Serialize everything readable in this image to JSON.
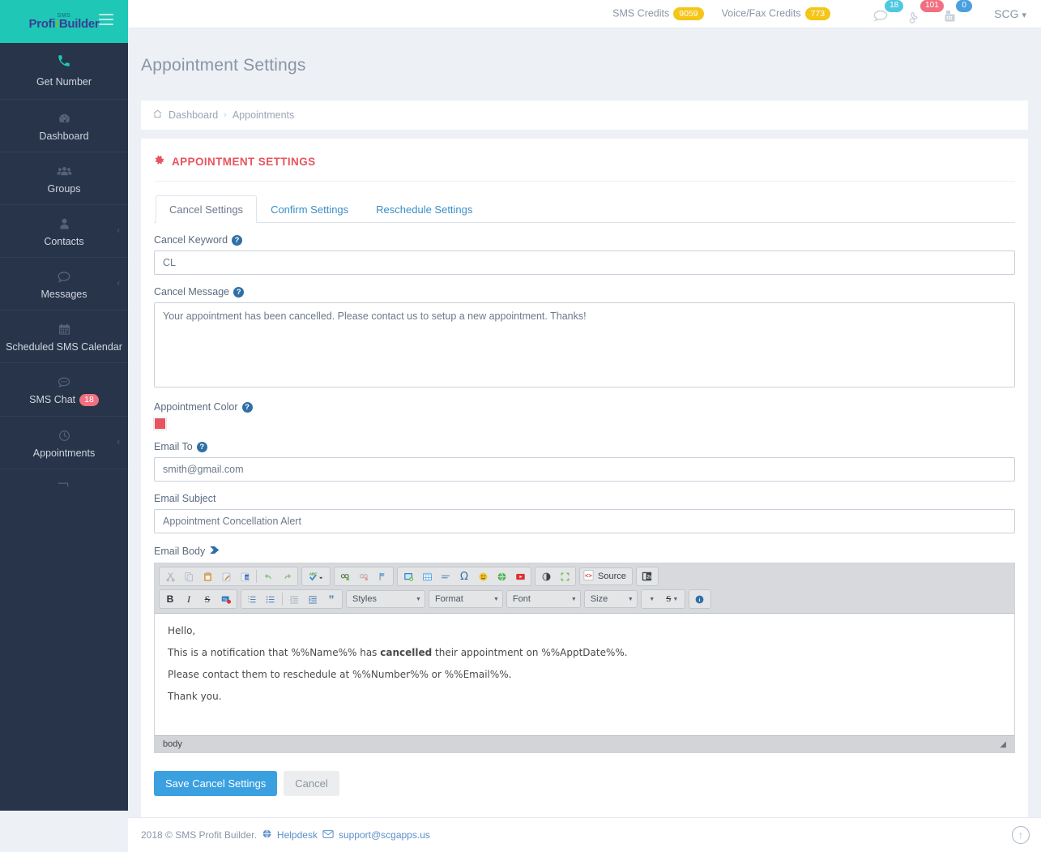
{
  "brand": {
    "top": "SMS",
    "name_part1": "Profi",
    "name_part2": "t",
    "name_part3": "Builder"
  },
  "sidebar": {
    "get_number": {
      "label": "Get Number",
      "icon": "phone-icon"
    },
    "items": [
      {
        "label": "Dashboard",
        "icon": "dashboard-icon",
        "caret": false,
        "badge": null
      },
      {
        "label": "Groups",
        "icon": "groups-icon",
        "caret": false,
        "badge": null
      },
      {
        "label": "Contacts",
        "icon": "contact-icon",
        "caret": true,
        "badge": null
      },
      {
        "label": "Messages",
        "icon": "message-icon",
        "caret": true,
        "badge": null
      },
      {
        "label": "Scheduled SMS Calendar",
        "icon": "calendar-icon",
        "caret": false,
        "badge": null
      },
      {
        "label": "SMS Chat",
        "icon": "chat-icon",
        "caret": false,
        "badge": "18"
      },
      {
        "label": "Appointments",
        "icon": "clock-icon",
        "caret": true,
        "badge": null
      }
    ]
  },
  "topbar": {
    "sms_credits_label": "SMS Credits",
    "sms_credits_value": "9059",
    "voice_fax_label": "Voice/Fax Credits",
    "voice_fax_value": "773",
    "icons": [
      {
        "name": "chat-bubble-icon",
        "badge": "18",
        "badge_color": "#4ec8e0"
      },
      {
        "name": "phone-icon",
        "badge": "101",
        "badge_color": "#f1707f"
      },
      {
        "name": "fax-icon",
        "badge": "0",
        "badge_color": "#4a9fe0"
      }
    ],
    "user": "SCG"
  },
  "page": {
    "title": "Appointment Settings",
    "breadcrumb": [
      "Dashboard",
      "Appointments"
    ],
    "breadcrumb_separator": "›",
    "home_icon": "home-icon"
  },
  "panel": {
    "heading": "APPOINTMENT SETTINGS",
    "heading_icon": "gear-icon",
    "tabs": [
      {
        "label": "Cancel Settings",
        "active": true
      },
      {
        "label": "Confirm Settings",
        "active": false
      },
      {
        "label": "Reschedule Settings",
        "active": false
      }
    ],
    "fields": {
      "cancel_keyword": {
        "label": "Cancel Keyword",
        "value": "CL",
        "has_help": true
      },
      "cancel_message": {
        "label": "Cancel Message",
        "value": "Your appointment has been cancelled. Please contact us to setup a new appointment. Thanks!",
        "has_help": true
      },
      "appointment_color": {
        "label": "Appointment Color",
        "color": "#e8545f",
        "has_help": true
      },
      "email_to": {
        "label": "Email To",
        "value": "smith@gmail.com",
        "has_help": true
      },
      "email_subject": {
        "label": "Email Subject",
        "value": "Appointment Concellation Alert",
        "has_help": false
      },
      "email_body": {
        "label": "Email Body",
        "icon": "tag-icon"
      }
    },
    "editor": {
      "toolbar_row1": [
        {
          "name": "cut-icon",
          "glyph": "✂",
          "color": "#9aa0a6"
        },
        {
          "name": "copy-icon",
          "glyph": "⧉",
          "color": "#aab4c0"
        },
        {
          "name": "paste-icon",
          "glyph": "Ὄb",
          "color": "#d8a15a"
        },
        {
          "name": "paste-text-icon",
          "glyph": "✎",
          "color": "#c98f3d"
        },
        {
          "name": "paste-from-word-icon",
          "glyph": "W",
          "color": "#3a6fb5"
        },
        {
          "name": "undo-icon",
          "glyph": "↶",
          "color": "#7ebb7a"
        },
        {
          "name": "redo-icon",
          "glyph": "↷",
          "color": "#7ebb7a"
        },
        {
          "name": "spellcheck-icon",
          "glyph": "✔",
          "color": "#3a8ec6"
        },
        {
          "name": "link-icon",
          "glyph": "⚭",
          "color": "#4c8b3e"
        },
        {
          "name": "unlink-icon",
          "glyph": "⚭",
          "color": "#c9a0a0"
        },
        {
          "name": "anchor-icon",
          "glyph": "⚑",
          "color": "#4a9fe0"
        },
        {
          "name": "image-icon",
          "glyph": "▣",
          "color": "#3a7fc0"
        },
        {
          "name": "table-icon",
          "glyph": "☷",
          "color": "#4a9fe0"
        },
        {
          "name": "horizontal-rule-icon",
          "glyph": "≡",
          "color": "#6d93b8"
        },
        {
          "name": "special-char-icon",
          "glyph": "Ω",
          "color": "#2f6fa8"
        },
        {
          "name": "smiley-icon",
          "glyph": "☺",
          "color": "#e8b63a"
        },
        {
          "name": "iframe-icon",
          "glyph": "●",
          "color": "#4caf50"
        },
        {
          "name": "youtube-icon",
          "glyph": "▶",
          "color": "#d33"
        },
        {
          "name": "show-blocks-icon",
          "glyph": "◑",
          "color": "#545a62"
        },
        {
          "name": "maximize-icon",
          "glyph": "⛶",
          "color": "#6cbf45"
        },
        {
          "name": "source-button",
          "glyph": "‹›",
          "label": "Source",
          "color": "#d33"
        },
        {
          "name": "templates-icon",
          "glyph": "❐",
          "color": "#3d434b"
        }
      ],
      "toolbar_row2": [
        {
          "name": "bold-icon",
          "glyph": "B",
          "color": "#2c3036"
        },
        {
          "name": "italic-icon",
          "glyph": "I",
          "color": "#2c3036"
        },
        {
          "name": "strikethrough-icon",
          "glyph": "S",
          "color": "#2c3036"
        },
        {
          "name": "remove-format-icon",
          "glyph": "▤",
          "color": "#3a7fc0"
        },
        {
          "name": "numbered-list-icon",
          "glyph": "☰",
          "color": "#4a7fb5"
        },
        {
          "name": "bulleted-list-icon",
          "glyph": "☰",
          "color": "#4a7fb5"
        },
        {
          "name": "outdent-icon",
          "glyph": "⇤",
          "color": "#9aa4b0"
        },
        {
          "name": "indent-icon",
          "glyph": "⇥",
          "color": "#4a7fb5"
        },
        {
          "name": "blockquote-icon",
          "glyph": "”",
          "color": "#4a7fb5"
        }
      ],
      "combos": [
        {
          "name": "styles-select",
          "label": "Styles"
        },
        {
          "name": "format-select",
          "label": "Format"
        },
        {
          "name": "font-select",
          "label": "Font"
        },
        {
          "name": "size-select",
          "label": "Size"
        }
      ],
      "text_color_icon": "text-color-icon",
      "bg_color_icon": "background-color-icon",
      "about_icon": "info-icon",
      "body_paragraphs": [
        "Hello,",
        "This is a notification that %%Name%% has <b>cancelled</b> their appointment on %%ApptDate%%.",
        "Please contact them to reschedule at %%Number%% or %%Email%%.",
        "Thank you."
      ],
      "status_path": "body",
      "resize_handle": "resize-handle"
    },
    "buttons": {
      "save": "Save Cancel Settings",
      "cancel": "Cancel"
    }
  },
  "footer": {
    "copyright": "2018 © SMS Profit Builder.",
    "helpdesk_icon": "globe-icon",
    "helpdesk": "Helpdesk",
    "email_icon": "envelope-icon",
    "email": "support@scgapps.us",
    "to_top_icon": "arrow-up-icon"
  },
  "colors": {
    "brand_teal": "#1ec7b6",
    "sidebar": "#283449",
    "accent_red": "#e8545f",
    "primary_blue": "#3aa0e0",
    "credit_pill": "#f5c518"
  }
}
